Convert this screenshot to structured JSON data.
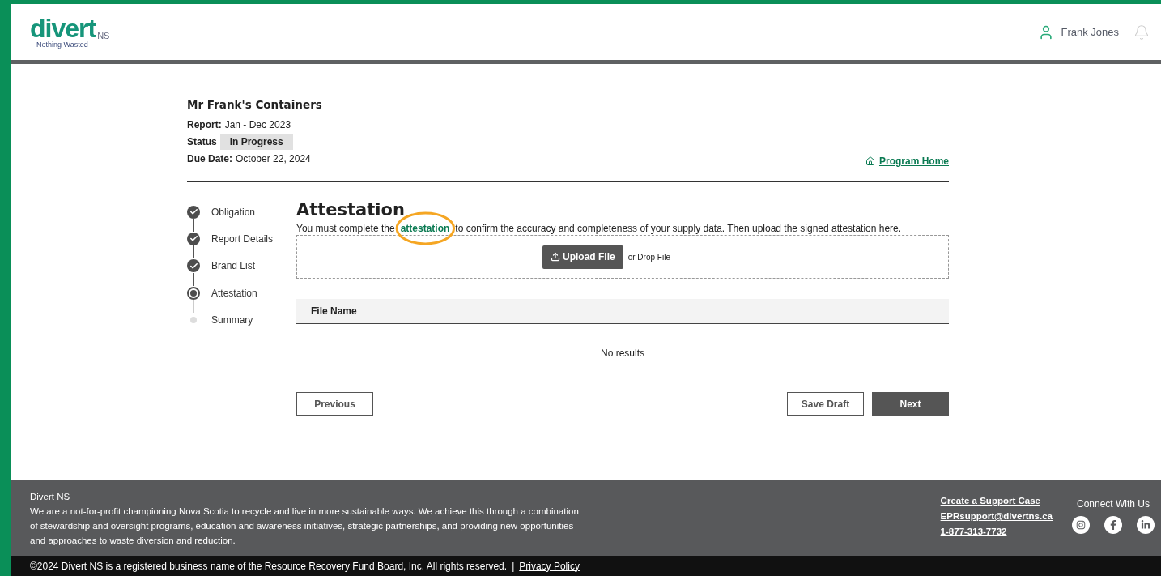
{
  "header": {
    "logo": {
      "wordmark": "divert",
      "suffix": "NS",
      "tagline": "Nothing Wasted"
    },
    "user": {
      "name": "Frank Jones"
    }
  },
  "report": {
    "company": "Mr Frank's Containers",
    "fields": [
      {
        "label": "Report:",
        "value": "Jan - Dec 2023",
        "kind": "text"
      },
      {
        "label": "Status",
        "value": "In Progress",
        "kind": "badge"
      },
      {
        "label": "Due Date:",
        "value": "October 22, 2024",
        "kind": "text"
      }
    ],
    "home_link": "Program Home"
  },
  "steps": [
    {
      "label": "Obligation",
      "completed": true,
      "selected": false
    },
    {
      "label": "Report Details",
      "completed": true,
      "selected": false
    },
    {
      "label": "Brand List",
      "completed": true,
      "selected": false
    },
    {
      "label": "Attestation",
      "completed": false,
      "selected": true
    },
    {
      "label": "Summary",
      "completed": false,
      "selected": false
    }
  ],
  "section": {
    "title": "Attestation",
    "intro_before": "You must complete the",
    "intro_link": "attestation",
    "intro_after": "to confirm the accuracy and completeness of your supply data. Then upload the signed attestation here.",
    "upload_button": "Upload File",
    "drop_hint": "or Drop File",
    "annotation": {
      "kind": "ellipse",
      "color": "#f5a623"
    }
  },
  "table": {
    "columns": [
      "File Name"
    ],
    "empty_text": "No results"
  },
  "buttons": {
    "previous": "Previous",
    "save": "Save Draft",
    "next": "Next"
  },
  "footer": {
    "title": "Divert NS",
    "about": "We are a not-for-profit championing Nova Scotia to recycle and live in more sustainable ways. We achieve this through a combination of stewardship and oversight programs, education and awareness initiatives, strategic partnerships, and providing new opportunities and approaches to waste diversion and reduction.",
    "links": [
      "Create a Support Case",
      "EPRsupport@divertns.ca",
      "1-877-313-7732"
    ],
    "social_title": "Connect With Us",
    "social": [
      {
        "kind": "instagram"
      },
      {
        "kind": "facebook"
      },
      {
        "kind": "linkedin"
      }
    ],
    "copyright": "©2024 Divert NS is a registered business name of the Resource Recovery Fund Board, Inc. All rights reserved.",
    "separator": "|",
    "privacy": "Privacy Policy"
  }
}
